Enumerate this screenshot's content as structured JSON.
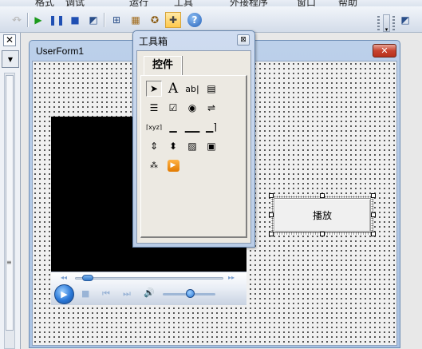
{
  "menu_strip": {
    "items": [
      "格式",
      "调试",
      "运行",
      "工具",
      "外接程序",
      "窗口",
      "帮助"
    ]
  },
  "toolbar": {
    "buttons": [
      {
        "icon": "redo-icon"
      },
      {
        "icon": "run-icon",
        "glyph": "▶"
      },
      {
        "icon": "pause-icon",
        "glyph": "⏸"
      },
      {
        "icon": "stop-icon",
        "glyph": "■"
      },
      {
        "icon": "design-mode-icon",
        "glyph": "📐"
      },
      {
        "icon": "project-explorer-icon",
        "glyph": "🗂"
      },
      {
        "icon": "properties-window-icon",
        "glyph": "📋"
      },
      {
        "icon": "object-browser-icon",
        "glyph": "🛠"
      },
      {
        "icon": "toolbox-icon",
        "glyph": "⚒",
        "active": true
      },
      {
        "icon": "help-icon",
        "glyph": "?"
      }
    ]
  },
  "left_panel": {
    "close_label": "✕",
    "combo_arrow": "▼",
    "scroll_grip": "≡"
  },
  "userform": {
    "title": "UserForm1",
    "close_label": "✕"
  },
  "media_player": {
    "seek_position": 0.05,
    "volume_level": 0.5,
    "icons": [
      "play-icon",
      "stop-icon",
      "previous-icon",
      "next-icon",
      "volume-icon"
    ]
  },
  "command_button": {
    "caption": "播放"
  },
  "toolbox": {
    "title": "工具箱",
    "close_label": "⊠",
    "tab_label": "控件",
    "tools": [
      {
        "name": "select-objects",
        "glyph": "➤"
      },
      {
        "name": "label",
        "glyph": "A"
      },
      {
        "name": "textbox",
        "glyph": "ab|"
      },
      {
        "name": "combobox",
        "glyph": "▤"
      },
      {
        "name": "listbox",
        "glyph": "☰"
      },
      {
        "name": "checkbox",
        "glyph": "☑"
      },
      {
        "name": "optionbutton",
        "glyph": "◉"
      },
      {
        "name": "togglebutton",
        "glyph": "⇌"
      },
      {
        "name": "frame",
        "glyph": "⌈xyz"
      },
      {
        "name": "commandbutton",
        "glyph": "▭"
      },
      {
        "name": "tabstrip",
        "glyph": "⊓"
      },
      {
        "name": "multipage",
        "glyph": "⊔"
      },
      {
        "name": "scrollbar",
        "glyph": "⇕"
      },
      {
        "name": "spinbutton",
        "glyph": "⬍"
      },
      {
        "name": "image",
        "glyph": "🖼"
      },
      {
        "name": "refedit",
        "glyph": "▣"
      },
      {
        "name": "treeview",
        "glyph": "⁂"
      },
      {
        "name": "windows-media-player",
        "glyph": "▶"
      }
    ]
  }
}
